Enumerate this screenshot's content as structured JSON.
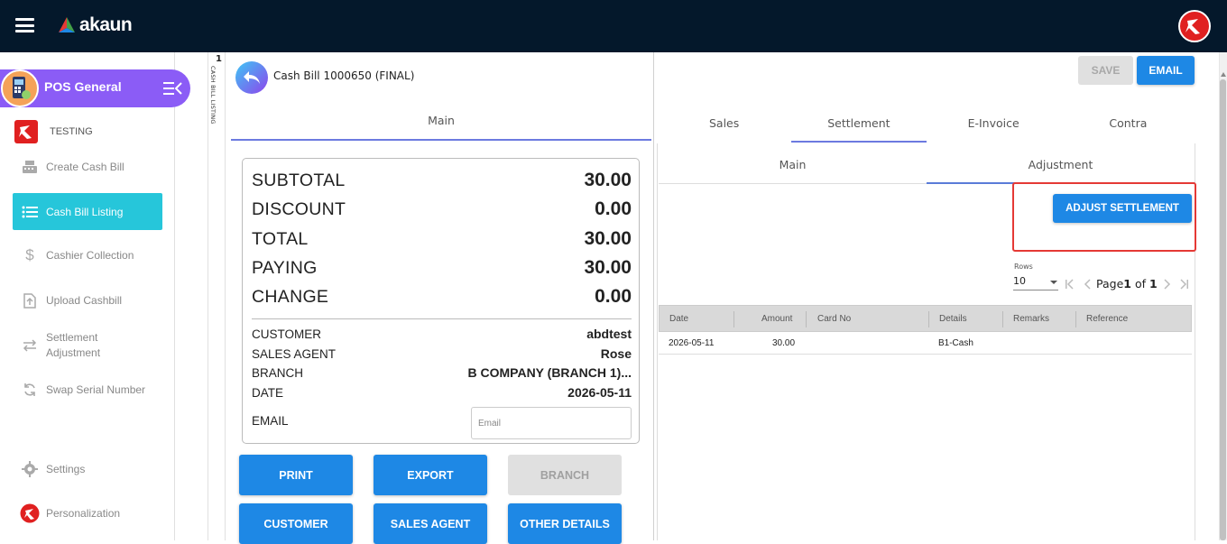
{
  "topbar": {
    "brand": "akaun"
  },
  "sidebar": {
    "app_name": "POS General",
    "tenant": "TESTING",
    "items": [
      {
        "label": "Create Cash Bill"
      },
      {
        "label": "Cash Bill Listing"
      },
      {
        "label": "Cashier Collection"
      },
      {
        "label": "Upload Cashbill"
      },
      {
        "label": "Settlement Adjustment"
      },
      {
        "label": "Swap Serial Number"
      },
      {
        "label": "Settings"
      },
      {
        "label": "Personalization"
      }
    ]
  },
  "strip": {
    "count": "1",
    "label": "CASH BILL LISTING"
  },
  "doc": {
    "title": "Cash Bill 1000650 (FINAL)",
    "tab": "Main"
  },
  "summary": {
    "subtotal_label": "SUBTOTAL",
    "subtotal": "30.00",
    "discount_label": "DISCOUNT",
    "discount": "0.00",
    "total_label": "TOTAL",
    "total": "30.00",
    "paying_label": "PAYING",
    "paying": "30.00",
    "change_label": "CHANGE",
    "change": "0.00",
    "customer_label": "CUSTOMER",
    "customer": "abdtest",
    "agent_label": "SALES AGENT",
    "agent": "Rose",
    "branch_label": "BRANCH",
    "branch": "B COMPANY (BRANCH 1)...",
    "date_label": "DATE",
    "date": "2026-05-11",
    "email_label": "EMAIL",
    "email_placeholder": "Email"
  },
  "actions": {
    "print": "PRINT",
    "export": "EXPORT",
    "branch": "BRANCH",
    "customer": "CUSTOMER",
    "sales_agent": "SALES AGENT",
    "other_details": "OTHER DETAILS"
  },
  "right": {
    "save": "SAVE",
    "email": "EMAIL",
    "tabs": [
      "Sales",
      "Settlement",
      "E-Invoice",
      "Contra"
    ],
    "sub_tabs": [
      "Main",
      "Adjustment"
    ],
    "adjust_button": "ADJUST SETTLEMENT",
    "rows_label": "Rows",
    "rows_value": "10",
    "page_prefix": "Page",
    "page_current": "1",
    "page_of": "of",
    "page_total": "1",
    "table": {
      "headers": [
        "Date",
        "Amount",
        "Card No",
        "Details",
        "Remarks",
        "Reference"
      ],
      "rows": [
        [
          "2026-05-11",
          "30.00",
          "",
          "B1-Cash",
          "",
          ""
        ]
      ]
    }
  }
}
